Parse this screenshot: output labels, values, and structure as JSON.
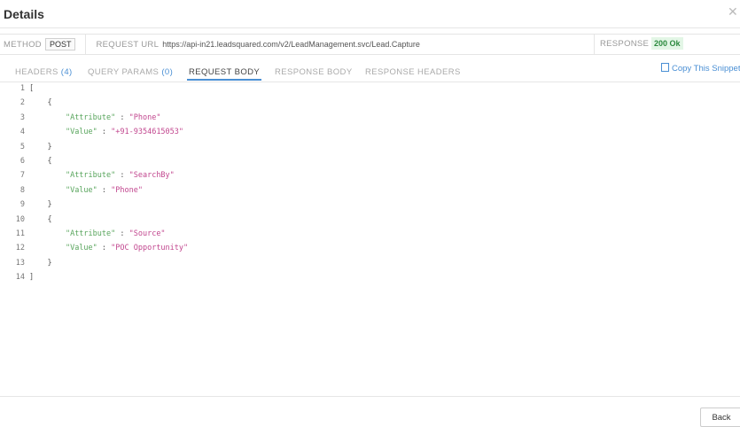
{
  "dialog": {
    "title": "Details",
    "close_icon": "close-icon"
  },
  "request": {
    "method_label": "METHOD",
    "method": "POST",
    "url_label": "REQUEST URL",
    "url": "https://api-in21.leadsquared.com/v2/LeadManagement.svc/Lead.Capture",
    "response_label": "RESPONSE",
    "response": "200 Ok",
    "response_color": "#2b8a3e"
  },
  "tabs": [
    {
      "label": "HEADERS",
      "count": "(4)"
    },
    {
      "label": "QUERY PARAMS",
      "count": "(0)"
    },
    {
      "label": "REQUEST BODY",
      "count": ""
    },
    {
      "label": "RESPONSE BODY",
      "count": ""
    },
    {
      "label": "RESPONSE HEADERS",
      "count": ""
    }
  ],
  "active_tab": "REQUEST BODY",
  "copy_label": "Copy This Snippet",
  "code_lines": [
    {
      "n": "1",
      "text": "["
    },
    {
      "n": "2",
      "text": "    {"
    },
    {
      "n": "3",
      "key": "\"Attribute\"",
      "val": "\"Phone\""
    },
    {
      "n": "4",
      "key": "\"Value\"",
      "val": "\"+91-9354615053\""
    },
    {
      "n": "5",
      "text": "    }"
    },
    {
      "n": "6",
      "text": "    {"
    },
    {
      "n": "7",
      "key": "\"Attribute\"",
      "val": "\"SearchBy\""
    },
    {
      "n": "8",
      "key": "\"Value\"",
      "val": "\"Phone\""
    },
    {
      "n": "9",
      "text": "    }"
    },
    {
      "n": "10",
      "text": "    {"
    },
    {
      "n": "11",
      "key": "\"Attribute\"",
      "val": "\"Source\""
    },
    {
      "n": "12",
      "key": "\"Value\"",
      "val": "\"POC Opportunity\""
    },
    {
      "n": "13",
      "text": "    }"
    },
    {
      "n": "14",
      "text": "]"
    }
  ],
  "footer": {
    "back_label": "Back"
  }
}
